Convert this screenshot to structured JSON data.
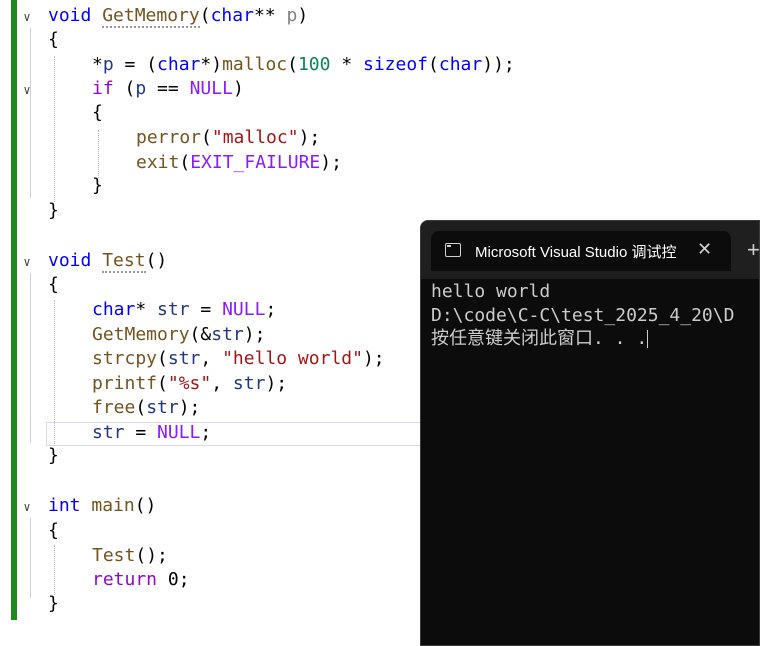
{
  "code": {
    "getmemory_sig": {
      "kw": "void",
      "name": "GetMemory",
      "p1": "(",
      "t1": "char",
      "p2": "** ",
      "arg": "p",
      "p3": ")"
    },
    "brace_open": "{",
    "brace_close": "}",
    "malloc_line": {
      "deref": "*",
      "var": "p",
      "eq": " = (",
      "type": "char",
      "cast": "*)",
      "fn": "malloc",
      "open": "(",
      "num": "100",
      "times": " * ",
      "sizeof": "sizeof",
      "open2": "(",
      "type2": "char",
      "close": "));"
    },
    "if_line": {
      "kw": "if",
      "open": " (",
      "var": "p",
      "eq": " == ",
      "null": "NULL",
      "close": ")"
    },
    "perror_line": {
      "fn": "perror",
      "open": "(",
      "str": "\"malloc\"",
      "close": ");"
    },
    "exit_line": {
      "fn": "exit",
      "open": "(",
      "macro": "EXIT_FAILURE",
      "close": ");"
    },
    "test_sig": {
      "kw": "void",
      "name": "Test",
      "rest": "()"
    },
    "decl_line": {
      "type": "char",
      "star": "* ",
      "var": "str",
      "eq": " = ",
      "null": "NULL",
      "end": ";"
    },
    "getmem_call": {
      "fn": "GetMemory",
      "rest": "(&",
      "var": "str",
      "end": ");"
    },
    "strcpy_line": {
      "fn": "strcpy",
      "open": "(",
      "var": "str",
      "comma": ", ",
      "str": "\"hello world\"",
      "end": ");"
    },
    "printf_line": {
      "fn": "printf",
      "open": "(",
      "str": "\"%s\"",
      "comma": ", ",
      "var": "str",
      "end": ");"
    },
    "free_line": {
      "fn": "free",
      "open": "(",
      "var": "str",
      "end": ");"
    },
    "assign_line": {
      "var": "str",
      "eq": " = ",
      "null": "NULL",
      "end": ";"
    },
    "main_sig": {
      "kw": "int",
      "name": "main",
      "rest": "()"
    },
    "test_call": {
      "fn": "Test",
      "rest": "();"
    },
    "return_line": {
      "kw": "return",
      "sp": " ",
      "num": "0",
      "end": ";"
    }
  },
  "console": {
    "tab_title": "Microsoft Visual Studio 调试控",
    "close_glyph": "✕",
    "add_glyph": "+",
    "lines": [
      "hello world",
      "D:\\code\\C-C\\test_2025_4_20\\D",
      "按任意键关闭此窗口. . ."
    ]
  },
  "fold_glyph": "∨"
}
